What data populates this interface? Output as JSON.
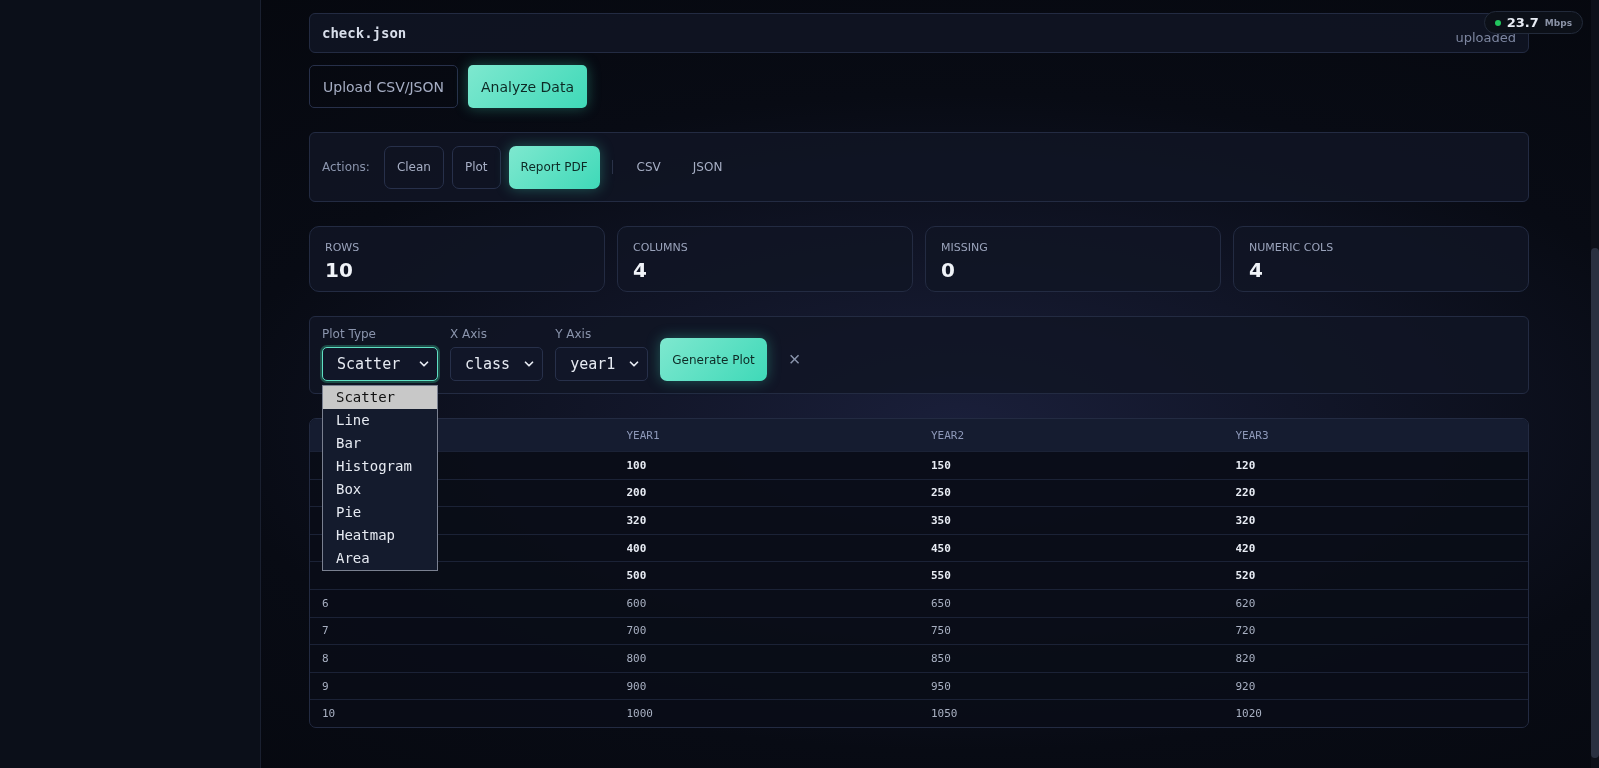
{
  "file": {
    "name": "check.json",
    "status": "uploaded"
  },
  "speed": {
    "value": "23.7",
    "unit": "Mbps"
  },
  "upload_buttons": [
    {
      "label": "Upload CSV/JSON",
      "primary": false
    },
    {
      "label": "Analyze Data",
      "primary": true
    }
  ],
  "actions": {
    "label": "Actions:",
    "buttons": [
      {
        "label": "Clean",
        "kind": "outline"
      },
      {
        "label": "Plot",
        "kind": "outline"
      },
      {
        "label": "Report PDF",
        "kind": "primary"
      },
      {
        "kind": "separator"
      },
      {
        "label": "CSV",
        "kind": "ghost"
      },
      {
        "label": "JSON",
        "kind": "ghost"
      }
    ]
  },
  "stats": [
    {
      "label": "ROWS",
      "value": "10"
    },
    {
      "label": "COLUMNS",
      "value": "4"
    },
    {
      "label": "MISSING",
      "value": "0"
    },
    {
      "label": "NUMERIC COLS",
      "value": "4"
    }
  ],
  "plot_controls": {
    "selects": [
      {
        "label": "Plot Type",
        "value": "Scatter",
        "expanded": true,
        "options": [
          {
            "label": "Scatter",
            "selected": true
          },
          {
            "label": "Line",
            "selected": false
          },
          {
            "label": "Bar",
            "selected": false
          },
          {
            "label": "Histogram",
            "selected": false
          },
          {
            "label": "Box",
            "selected": false
          },
          {
            "label": "Pie",
            "selected": false
          },
          {
            "label": "Heatmap",
            "selected": false
          },
          {
            "label": "Area",
            "selected": false
          }
        ]
      },
      {
        "label": "X Axis",
        "value": "class",
        "expanded": false
      },
      {
        "label": "Y Axis",
        "value": "year1",
        "expanded": false
      }
    ],
    "generate_button": "Generate Plot",
    "close": "×"
  },
  "table": {
    "columns": [
      "YEAR1",
      "YEAR2",
      "YEAR3"
    ],
    "rows": [
      {
        "values": [
          "100",
          "150",
          "120"
        ]
      },
      {
        "values": [
          "200",
          "250",
          "220"
        ]
      },
      {
        "values": [
          "320",
          "350",
          "320"
        ]
      },
      {
        "values": [
          "400",
          "450",
          "420"
        ]
      },
      {
        "values": [
          "500",
          "550",
          "520"
        ]
      },
      {
        "column_1": "6",
        "values": [
          "600",
          "650",
          "620"
        ]
      },
      {
        "column_1": "7",
        "values": [
          "700",
          "750",
          "720"
        ]
      },
      {
        "column_1": "8",
        "values": [
          "800",
          "850",
          "820"
        ]
      },
      {
        "column_1": "9",
        "values": [
          "900",
          "950",
          "920"
        ]
      },
      {
        "column_1": "10",
        "values": [
          "1000",
          "1050",
          "1020"
        ]
      }
    ]
  }
}
